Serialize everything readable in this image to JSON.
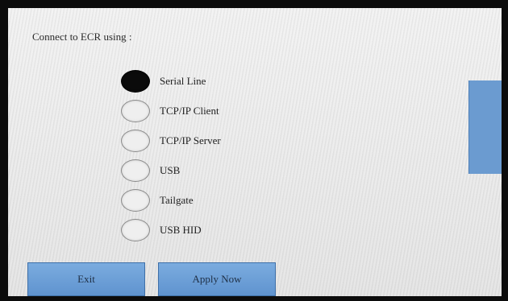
{
  "dialog": {
    "title": "Connect to ECR using :"
  },
  "options": [
    {
      "label": "Serial Line",
      "selected": true
    },
    {
      "label": "TCP/IP Client",
      "selected": false
    },
    {
      "label": "TCP/IP Server",
      "selected": false
    },
    {
      "label": "USB",
      "selected": false
    },
    {
      "label": "Tailgate",
      "selected": false
    },
    {
      "label": "USB HID",
      "selected": false
    }
  ],
  "buttons": {
    "exit": "Exit",
    "apply": "Apply Now"
  },
  "colors": {
    "button_blue": "#6b9bd0",
    "selected_radio": "#0b0b0b"
  }
}
